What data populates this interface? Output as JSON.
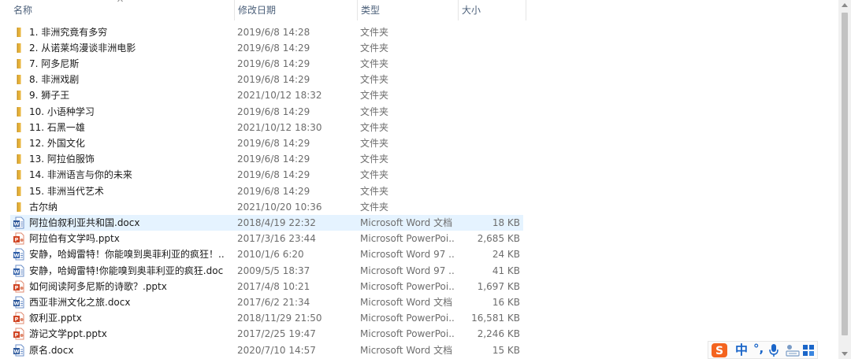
{
  "columns": {
    "name": "名称",
    "date": "修改日期",
    "type": "类型",
    "size": "大小"
  },
  "rows": [
    {
      "name": "1. 非洲究竟有多穷",
      "date": "2019/6/8 14:28",
      "type": "文件夹",
      "size": "",
      "icon": "folder-icon"
    },
    {
      "name": "2. 从诺莱坞漫谈非洲电影",
      "date": "2019/6/8 14:29",
      "type": "文件夹",
      "size": "",
      "icon": "folder-icon"
    },
    {
      "name": "7. 阿多尼斯",
      "date": "2019/6/8 14:29",
      "type": "文件夹",
      "size": "",
      "icon": "folder-icon"
    },
    {
      "name": "8. 非洲戏剧",
      "date": "2019/6/8 14:29",
      "type": "文件夹",
      "size": "",
      "icon": "folder-icon"
    },
    {
      "name": "9. 狮子王",
      "date": "2021/10/12 18:32",
      "type": "文件夹",
      "size": "",
      "icon": "folder-icon"
    },
    {
      "name": "10. 小语种学习",
      "date": "2019/6/8 14:29",
      "type": "文件夹",
      "size": "",
      "icon": "folder-icon"
    },
    {
      "name": "11. 石黑一雄",
      "date": "2021/10/12 18:30",
      "type": "文件夹",
      "size": "",
      "icon": "folder-icon"
    },
    {
      "name": "12. 外国文化",
      "date": "2019/6/8 14:29",
      "type": "文件夹",
      "size": "",
      "icon": "folder-icon"
    },
    {
      "name": "13. 阿拉伯服饰",
      "date": "2019/6/8 14:29",
      "type": "文件夹",
      "size": "",
      "icon": "folder-icon"
    },
    {
      "name": "14. 非洲语言与你的未来",
      "date": "2019/6/8 14:29",
      "type": "文件夹",
      "size": "",
      "icon": "folder-icon"
    },
    {
      "name": "15. 非洲当代艺术",
      "date": "2019/6/8 14:29",
      "type": "文件夹",
      "size": "",
      "icon": "folder-icon"
    },
    {
      "name": "古尔纳",
      "date": "2021/10/20 10:36",
      "type": "文件夹",
      "size": "",
      "icon": "folder-icon"
    },
    {
      "name": "阿拉伯叙利亚共和国.docx",
      "date": "2018/4/19 22:32",
      "type": "Microsoft Word 文档",
      "size": "18 KB",
      "icon": "word-doc-icon"
    },
    {
      "name": "阿拉伯有文学吗.pptx",
      "date": "2017/3/16 23:44",
      "type": "Microsoft PowerPoi...",
      "size": "2,685 KB",
      "icon": "powerpoint-icon"
    },
    {
      "name": "安静，哈姆雷特！你能嗅到奥菲利亚的疯狂！...",
      "date": "2010/1/6 6:20",
      "type": "Microsoft Word 97 ...",
      "size": "24 KB",
      "icon": "word-97-doc-icon"
    },
    {
      "name": "安静，哈姆雷特!你能嗅到奥菲利亚的疯狂.doc",
      "date": "2009/5/5 18:37",
      "type": "Microsoft Word 97 ...",
      "size": "41 KB",
      "icon": "word-97-doc-icon"
    },
    {
      "name": "如何阅读阿多尼斯的诗歌？.pptx",
      "date": "2017/4/8 10:21",
      "type": "Microsoft PowerPoi...",
      "size": "1,697 KB",
      "icon": "powerpoint-icon"
    },
    {
      "name": "西亚非洲文化之旅.docx",
      "date": "2017/6/2 21:34",
      "type": "Microsoft Word 文档",
      "size": "16 KB",
      "icon": "word-doc-icon"
    },
    {
      "name": "叙利亚.pptx",
      "date": "2018/11/29 21:50",
      "type": "Microsoft PowerPoi...",
      "size": "16,581 KB",
      "icon": "powerpoint-icon"
    },
    {
      "name": "游记文学ppt.pptx",
      "date": "2017/2/25 19:47",
      "type": "Microsoft PowerPoi...",
      "size": "2,246 KB",
      "icon": "powerpoint-icon"
    },
    {
      "name": "原名.docx",
      "date": "2020/7/10 14:57",
      "type": "Microsoft Word 文档",
      "size": "15 KB",
      "icon": "word-doc-icon"
    }
  ],
  "hover_row": 12,
  "ime": {
    "mode": "中",
    "punct": "°,"
  },
  "colors": {
    "header_text": "#4c607a",
    "hover_bg": "#e5f3ff",
    "folder": "#e8b43c",
    "word": "#2b579a",
    "powerpoint": "#d04423",
    "sogou": "#f4641f",
    "ime_blue": "#1b66c9"
  }
}
